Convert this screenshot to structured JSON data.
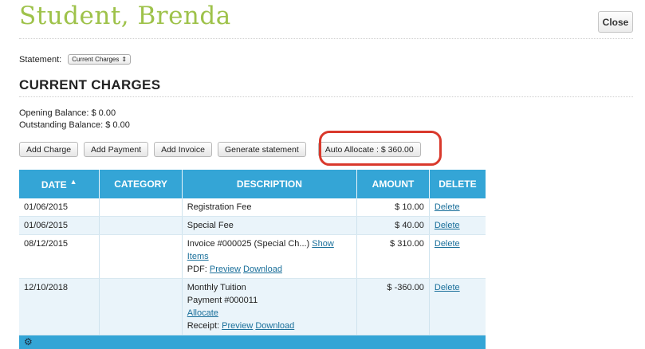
{
  "header": {
    "title": "Student, Brenda",
    "close_label": "Close"
  },
  "statement": {
    "label": "Statement:",
    "selected": "Current Charges",
    "chevron_icon": "updown-chevron-icon"
  },
  "section": {
    "title": "CURRENT CHARGES"
  },
  "balances": {
    "opening": "Opening Balance: $ 0.00",
    "outstanding": "Outstanding Balance: $ 0.00"
  },
  "actions": {
    "add_charge": "Add Charge",
    "add_payment": "Add Payment",
    "add_invoice": "Add Invoice",
    "generate_statement": "Generate statement",
    "auto_allocate": "Auto Allocate : $ 360.00"
  },
  "table": {
    "columns": {
      "date": "DATE",
      "category": "CATEGORY",
      "description": "DESCRIPTION",
      "amount": "AMOUNT",
      "delete": "DELETE"
    },
    "sort_icon": "sort-ascending-icon",
    "rows": [
      {
        "date": "01/06/2015",
        "category": "",
        "desc": "Registration Fee",
        "amount": "$ 10.00",
        "delete": "Delete"
      },
      {
        "date": "01/06/2015",
        "category": "",
        "desc": "Special Fee",
        "amount": "$ 40.00",
        "delete": "Delete"
      },
      {
        "date": "08/12/2015",
        "category": "",
        "desc": "Invoice #000025 (Special Ch...)",
        "show_items": "Show Items",
        "pdf_label": "PDF:",
        "preview": "Preview",
        "download": "Download",
        "amount": "$ 310.00",
        "delete": "Delete"
      },
      {
        "date": "12/10/2018",
        "category": "",
        "desc": "Monthly Tuition",
        "payment": "Payment #000011",
        "allocate": "Allocate",
        "receipt_label": "Receipt:",
        "preview": "Preview",
        "download": "Download",
        "amount": "$ -360.00",
        "delete": "Delete"
      }
    ],
    "footer_icon": "gear-icon"
  },
  "colors": {
    "title": "#9ec24a",
    "table_header": "#34a5d6",
    "highlight": "#d9392c",
    "link": "#1a6f9a"
  }
}
